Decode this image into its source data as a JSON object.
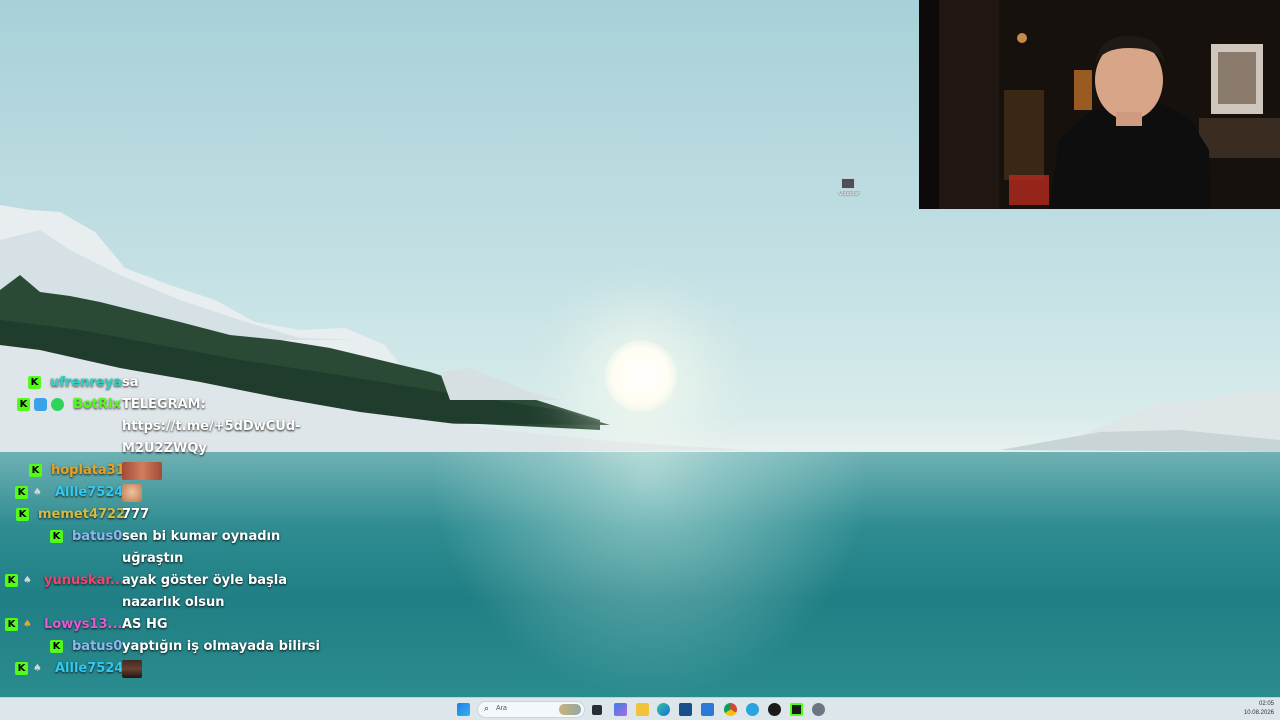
{
  "desktop_icon": {
    "label": "Videolar"
  },
  "chat": {
    "messages": [
      {
        "username": "ufrenreya",
        "color": "#2fd3c4",
        "badges": [
          "kick"
        ],
        "text": [
          "sa"
        ]
      },
      {
        "username": "BotRix",
        "color": "#53fc18",
        "badges": [
          "kick",
          "bot",
          "gem"
        ],
        "text": [
          "TELEGRAM:",
          "https://t.me/+5dDwCUd-",
          "M2U2ZWQy"
        ]
      },
      {
        "username": "hoplata31",
        "color": "#e9a21f",
        "badges": [
          "kick"
        ],
        "emote": "face-emote"
      },
      {
        "username": "Allle7524",
        "color": "#33c9ee",
        "badges": [
          "kick",
          "sub"
        ],
        "emote": "face-emote"
      },
      {
        "username": "memet4722",
        "color": "#d3bb46",
        "badges": [
          "kick"
        ],
        "text": [
          "777"
        ]
      },
      {
        "username": "batus0",
        "color": "#8db7f0",
        "badges": [
          "kick"
        ],
        "text": [
          "sen bi kumar oynadın",
          "uğraştın"
        ]
      },
      {
        "username": "yunuskar...",
        "color": "#f4446e",
        "badges": [
          "kick",
          "sub"
        ],
        "text": [
          "ayak göster öyle başla",
          "nazarlık olsun"
        ]
      },
      {
        "username": "Lowys13...",
        "color": "#e657d6",
        "badges": [
          "kick",
          "sub-gold"
        ],
        "text": [
          "AS HG"
        ]
      },
      {
        "username": "batus0",
        "color": "#8db7f0",
        "badges": [
          "kick"
        ],
        "text": [
          "yaptığın iş olmayada bilirsi"
        ]
      },
      {
        "username": "Allle7524",
        "color": "#33c9ee",
        "badges": [
          "kick",
          "sub"
        ],
        "emote": "person-emote"
      }
    ]
  },
  "taskbar": {
    "search_placeholder": "Ara",
    "clock_time": "02:05",
    "clock_date": "10.08.2026",
    "icons": [
      "windows-start-icon",
      "taskview-icon",
      "widgets-icon",
      "file-explorer-icon",
      "edge-icon",
      "store-icon",
      "mail-icon",
      "chrome-icon",
      "telegram-icon",
      "app-icon",
      "kick-icon",
      "settings-icon"
    ]
  }
}
